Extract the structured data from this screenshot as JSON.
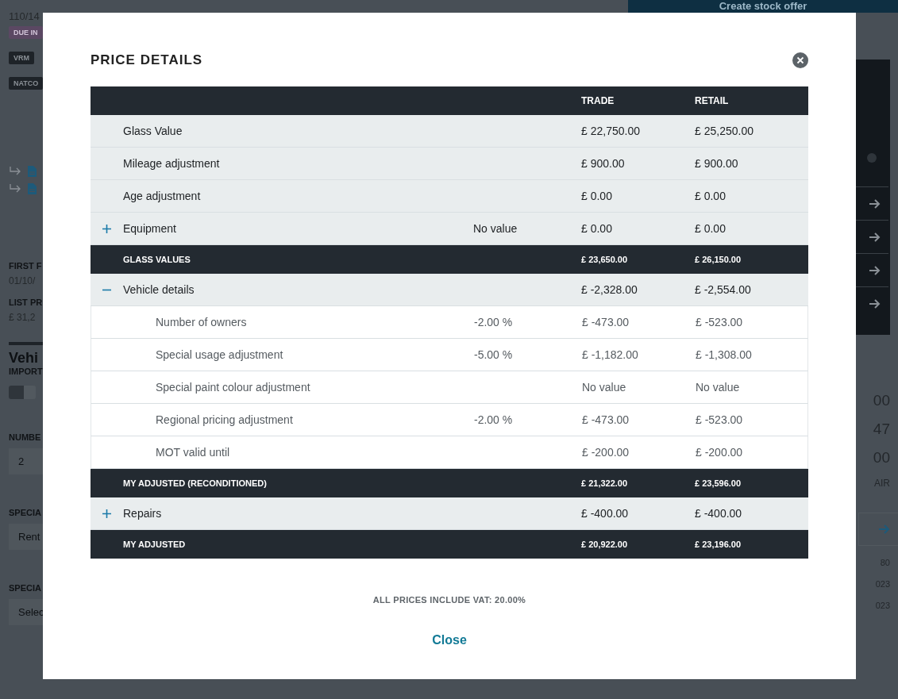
{
  "background": {
    "ref": "110/14",
    "status_badge": "DUE IN",
    "tags": [
      "VRM",
      "NATCO"
    ],
    "first_label": "FIRST F",
    "first_value": "01/10/",
    "list_label": "LIST PR",
    "list_value": "£ 31,2",
    "section_title": "Vehi",
    "import_label": "IMPORT",
    "import_toggle": {
      "on": true
    },
    "fields": [
      {
        "label": "NUMBE",
        "value": "2"
      },
      {
        "label": "SPECIA",
        "value": "Rent"
      },
      {
        "label": "SPECIA",
        "value": "Selec"
      }
    ],
    "action_button": "Create stock offer",
    "right_values": [
      "00",
      "47",
      "00"
    ],
    "right_caption": "AIR",
    "right_small": [
      "80",
      "023",
      "023"
    ]
  },
  "modal": {
    "title": "PRICE DETAILS",
    "columns": [
      "TRADE",
      "RETAIL"
    ],
    "rows": [
      {
        "kind": "item",
        "label": "Glass Value",
        "trade": "£ 22,750.00",
        "retail": "£ 25,250.00"
      },
      {
        "kind": "item",
        "label": "Mileage adjustment",
        "trade": "£ 900.00",
        "retail": "£ 900.00"
      },
      {
        "kind": "item",
        "label": "Age adjustment",
        "trade": "£ 0.00",
        "retail": "£ 0.00"
      },
      {
        "kind": "group",
        "expanded": false,
        "label": "Equipment",
        "note": "No value",
        "trade": "£ 0.00",
        "retail": "£ 0.00"
      },
      {
        "kind": "total",
        "label": "GLASS VALUES",
        "trade": "£ 23,650.00",
        "retail": "£ 26,150.00"
      },
      {
        "kind": "group",
        "expanded": true,
        "label": "Vehicle details",
        "trade": "£ -2,328.00",
        "retail": "£ -2,554.00"
      },
      {
        "kind": "sub",
        "label": "Number of owners",
        "note": "-2.00 %",
        "trade": "£ -473.00",
        "retail": "£ -523.00"
      },
      {
        "kind": "sub",
        "label": "Special usage adjustment",
        "note": "-5.00 %",
        "trade": "£ -1,182.00",
        "retail": "£ -1,308.00"
      },
      {
        "kind": "sub",
        "label": "Special paint colour adjustment",
        "trade": "No value",
        "retail": "No value"
      },
      {
        "kind": "sub",
        "label": "Regional pricing adjustment",
        "note": "-2.00 %",
        "trade": "£ -473.00",
        "retail": "£ -523.00"
      },
      {
        "kind": "sub",
        "label": "MOT valid until",
        "trade": "£ -200.00",
        "retail": "£ -200.00"
      },
      {
        "kind": "total",
        "label": "MY ADJUSTED (RECONDITIONED)",
        "trade": "£ 21,322.00",
        "retail": "£ 23,596.00"
      },
      {
        "kind": "group",
        "expanded": false,
        "label": "Repairs",
        "trade": "£ -400.00",
        "retail": "£ -400.00"
      },
      {
        "kind": "total",
        "label": "MY ADJUSTED",
        "trade": "£ 20,922.00",
        "retail": "£ 23,196.00"
      }
    ],
    "vat_note": "ALL PRICES INCLUDE VAT: 20.00%",
    "close_link": "Close"
  }
}
